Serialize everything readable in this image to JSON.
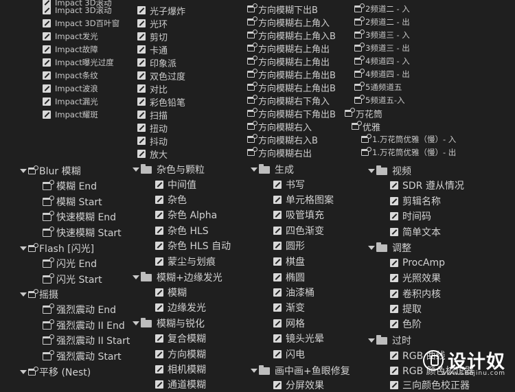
{
  "col1": {
    "impact": [
      "Impact 3D滚动",
      "Impact 3D百叶窗",
      "Impact发光",
      "Impact故障",
      "Impact曝光过度",
      "Impact条纹",
      "Impact波浪",
      "Impact漏光",
      "Impact耀斑"
    ],
    "blur": {
      "label": "Blur 模糊",
      "items": [
        "模糊 End",
        "模糊 Start",
        "快速模糊 End",
        "快速模糊 Start"
      ]
    },
    "flash": {
      "label": "Flash [闪光]",
      "items": [
        "闪光 End",
        "闪光 Start"
      ]
    },
    "shake": {
      "label": "摇摄",
      "items": [
        "强烈震动 End",
        "强烈震动 II End",
        "强烈震动 II Start",
        "强烈震动 Start"
      ]
    },
    "pan": {
      "label": "平移 (Nest)"
    }
  },
  "col2": {
    "top": [
      "光子爆炸",
      "光环",
      "剪切",
      "卡通",
      "印象派",
      "双色过度",
      "对比",
      "彩色铅笔",
      "扫描",
      "扭动",
      "抖动",
      "放大"
    ],
    "noise": {
      "label": "杂色与颗粒",
      "items": [
        "中间值",
        "杂色",
        "杂色 Alpha",
        "杂色 HLS",
        "杂色 HLS 自动",
        "蒙尘与划痕"
      ]
    },
    "blurglow": {
      "label": "模糊+边缘发光",
      "items": [
        "模糊",
        "边缘发光"
      ]
    },
    "blursharp": {
      "label": "模糊与锐化",
      "items": [
        "复合模糊",
        "方向模糊",
        "相机模糊",
        "通道模糊"
      ]
    }
  },
  "col3": {
    "top": [
      "方向模糊下出B",
      "方向模糊右上角入",
      "方向模糊右上角入B",
      "方向模糊右上角出",
      "方向模糊右上角出",
      "方向模糊右上角出B",
      "方向模糊右上角出B",
      "方向模糊右下角入",
      "方向模糊右下角出B",
      "方向模糊右入",
      "方向模糊右入B",
      "方向模糊右出"
    ],
    "gen": {
      "label": "生成",
      "items": [
        "书写",
        "单元格图案",
        "吸管填充",
        "四色渐变",
        "圆形",
        "棋盘",
        "椭圆",
        "油漆桶",
        "渐变",
        "网格",
        "镜头光晕",
        "闪电"
      ]
    },
    "pip": {
      "label": "画中画+鱼眼修复",
      "items": [
        "分屏效果"
      ]
    }
  },
  "col4": {
    "top": [
      "2频道二 - 入",
      "2频道二 - 出",
      "3频道三 - 入",
      "3频道三 - 出",
      "4频道四 - 入",
      "4频道四 - 出",
      "5通频道五",
      "5频道五-入"
    ],
    "kaleido": "万花筒",
    "elegant": {
      "label": "优雅",
      "items": [
        "1.万花筒优雅（慢）- 入",
        "1.万花筒优雅（慢）- 出"
      ]
    },
    "video": {
      "label": "视频",
      "items": [
        "SDR 遵从情况",
        "剪辑名称",
        "时间码",
        "简单文本"
      ]
    },
    "adjust": {
      "label": "调整",
      "items": [
        "ProcAmp",
        "光照效果",
        "卷积内核",
        "提取",
        "色阶"
      ]
    },
    "old": {
      "label": "过时",
      "items": [
        "RGB 曲线",
        "RGB 颜色校正器",
        "三向颜色校正器"
      ]
    }
  },
  "watermark": {
    "name": "设计奴",
    "url": "www.shejinu.com"
  }
}
